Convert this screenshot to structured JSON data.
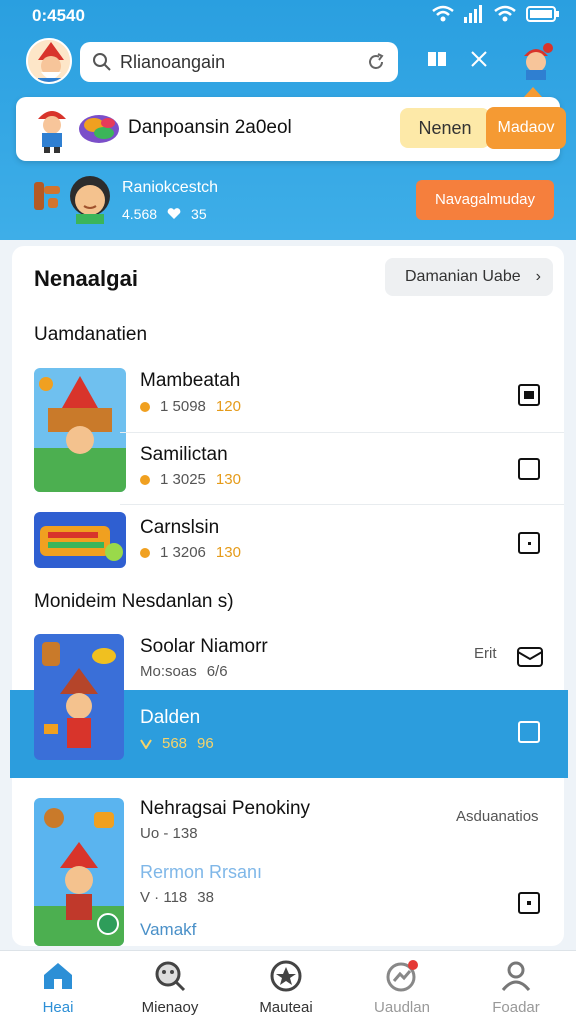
{
  "status": {
    "time": "0:4540"
  },
  "search": {
    "placeholder": "Rlianoangain"
  },
  "banner": {
    "title": "Danpoansin 2a0eol",
    "button_secondary": "Nenen",
    "button_primary": "Madaov"
  },
  "promo": {
    "name": "Raniokcestch",
    "count": "4.568",
    "likes": "35",
    "button": "Navagalmuday"
  },
  "card": {
    "heading": "Nenaalgai",
    "pill": "Damanian Uabe"
  },
  "sections": {
    "first": "Uamdanatien",
    "second": "Monideim Nesdanlan s)"
  },
  "list1": [
    {
      "title": "Mambeatah",
      "meta": "1 5098",
      "score": "120",
      "checked": true
    },
    {
      "title": "Samilictan",
      "meta": "1 3025",
      "score": "130",
      "checked": false
    },
    {
      "title": "Carnslsin",
      "meta": "1 3206",
      "score": "130",
      "checked": false
    }
  ],
  "list2": [
    {
      "title": "Soolar Niamorr",
      "meta": "Mo:soas",
      "score": "6/6",
      "side": "Erit"
    },
    {
      "title": "Dalden",
      "meta": "568",
      "score": "96"
    },
    {
      "title": "Nehragsai Penokiny",
      "meta": "Uo - 138",
      "side": "Asduanatios",
      "sub1": "Rermon Rrsanı",
      "sub1meta": "V · 118",
      "sub1score": "38",
      "sub2": "Vamakf"
    }
  ],
  "bottom_nav": [
    {
      "label": "Heai",
      "icon": "home-icon",
      "active": true
    },
    {
      "label": "Mienaoy",
      "icon": "magnifier-face-icon",
      "active": false
    },
    {
      "label": "Mauteai",
      "icon": "star-badge-icon",
      "active": false
    },
    {
      "label": "Uaudlan",
      "icon": "trend-icon",
      "active": false
    },
    {
      "label": "Foadar",
      "icon": "person-icon",
      "active": false
    }
  ],
  "colors": {
    "primary_blue": "#2c9ddd",
    "accent_orange": "#f59a33",
    "coin_gold": "#e59b1a"
  }
}
